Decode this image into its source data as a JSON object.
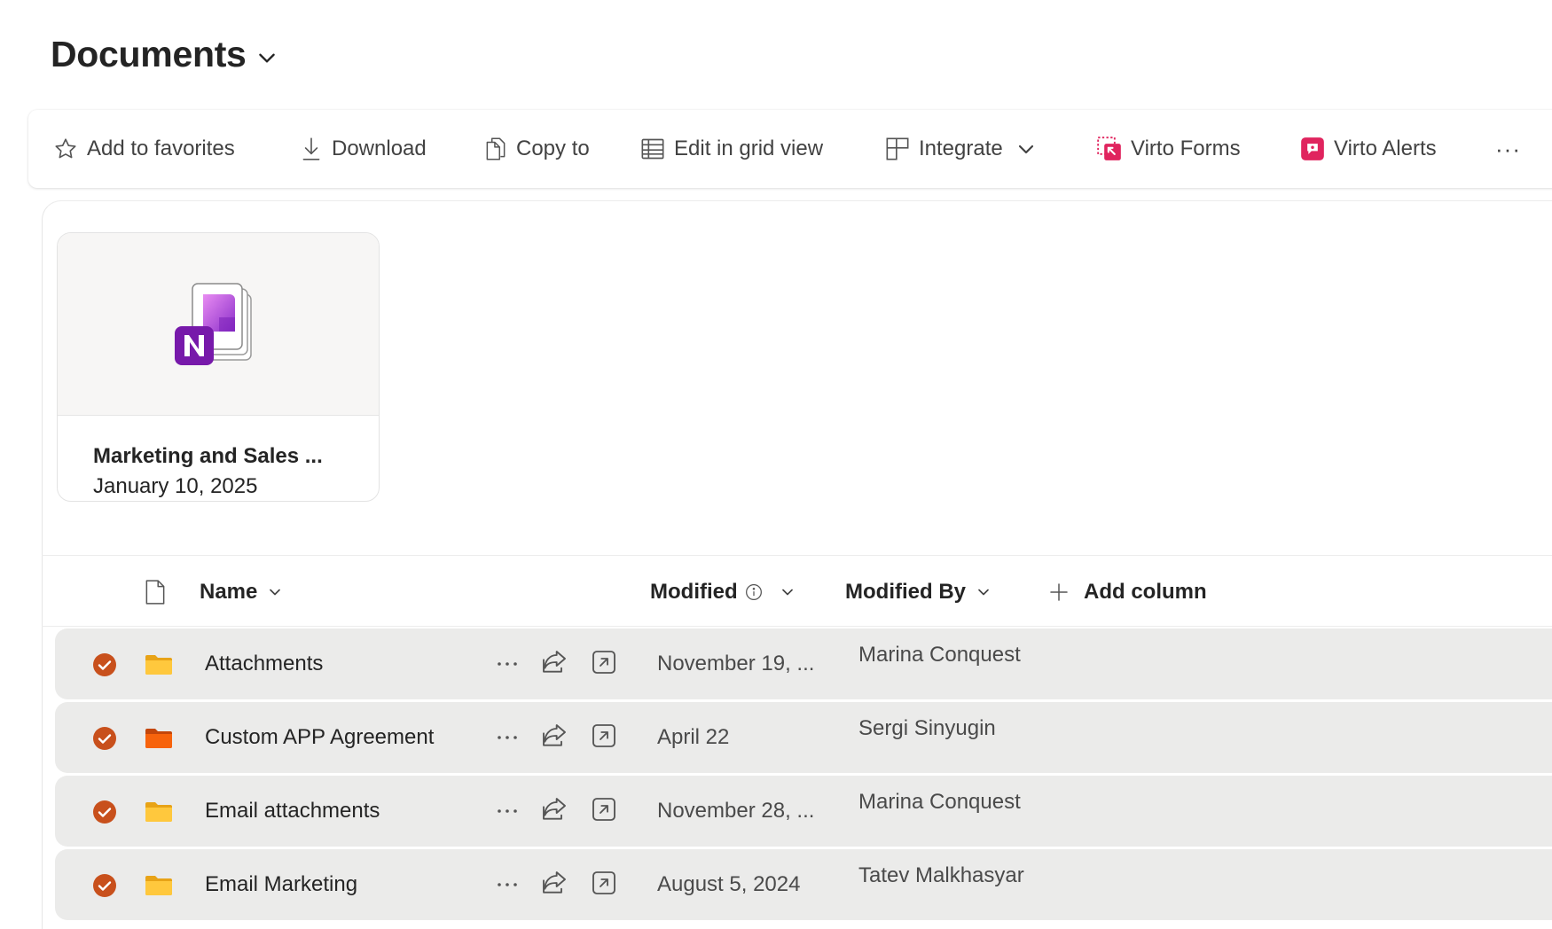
{
  "header": {
    "title": "Documents"
  },
  "command_bar": {
    "add_to_favorites": "Add to favorites",
    "download": "Download",
    "copy_to": "Copy to",
    "edit_in_grid_view": "Edit in grid view",
    "integrate": "Integrate",
    "virto_forms": "Virto Forms",
    "virto_alerts": "Virto Alerts",
    "more": "···"
  },
  "file_card": {
    "name": "Marketing and Sales ...",
    "date": "January 10, 2025",
    "icon": "onenote-icon"
  },
  "columns": {
    "name": "Name",
    "modified": "Modified",
    "modified_by": "Modified By",
    "add_column": "Add column"
  },
  "rows": [
    {
      "name": "Attachments",
      "modified": "November 19, ...",
      "modified_by": "Marina Conquest",
      "folder_color": "#ffc83d"
    },
    {
      "name": "Custom APP Agreement",
      "modified": "April 22",
      "modified_by": "Sergi Sinyugin",
      "folder_color": "#f7630c"
    },
    {
      "name": "Email attachments",
      "modified": "November 28, ...",
      "modified_by": "Marina Conquest",
      "folder_color": "#ffc83d"
    },
    {
      "name": "Email Marketing",
      "modified": "August 5, 2024",
      "modified_by": "Tatev Malkhasyar",
      "folder_color": "#ffc83d"
    }
  ],
  "colors": {
    "check": "#c8501c",
    "virto_accent": "#e0245e"
  },
  "row_more_label": "···"
}
